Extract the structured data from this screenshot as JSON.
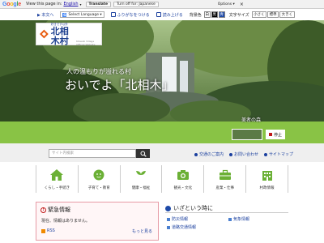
{
  "translate_bar": {
    "logo": [
      "G",
      "o",
      "o",
      "g",
      "l",
      "e"
    ],
    "view_text": "View this page in:",
    "language": "English",
    "translate_button": "Translate",
    "turn_off_button": "Turn off for: Japanese",
    "options": "Options ▾"
  },
  "utility": {
    "skip_link": "▶ 本文へ",
    "select_language": "Select Language",
    "furigana": "ふりがなをつける",
    "read_aloud": "読み上げる",
    "bg_label": "背景色",
    "bg_white": "白",
    "bg_black": "黒",
    "bg_blue": "青",
    "font_label": "文字サイズ",
    "font_small": "小さく",
    "font_std": "標準",
    "font_large": "大きく"
  },
  "header": {
    "logo_sub": "好きです以外",
    "logo_name": "北相木村",
    "logo_en": "Kitaaiki Village Official Website",
    "catch_small": "人の温もりが溢れる村",
    "catch_large": "おいでよ「北相木」",
    "photo_caption": "美者の森",
    "stop_label": "停止"
  },
  "search": {
    "placeholder": "サイト内検索",
    "link_traffic": "交通のご案内",
    "link_contact": "お問い合わせ",
    "link_sitemap": "サイトマップ"
  },
  "categories": [
    {
      "label": "くらし・手続き",
      "icon": "house-icon"
    },
    {
      "label": "子育て・教育",
      "icon": "child-icon"
    },
    {
      "label": "健康・福祉",
      "icon": "leaf-icon"
    },
    {
      "label": "観光・文化",
      "icon": "camera-icon"
    },
    {
      "label": "産業・仕事",
      "icon": "briefcase-icon"
    },
    {
      "label": "村政情報",
      "icon": "building-icon"
    }
  ],
  "emergency": {
    "title": "緊急情報",
    "body": "現在、情報はありません。",
    "rss": "RSS",
    "more": "もっと見る"
  },
  "iza": {
    "title": "いざという時に",
    "links": [
      "防災情報",
      "気象情報",
      "道路交通情報"
    ]
  },
  "colors": {
    "brand_blue": "#1c3f8f",
    "green_band": "#89c345",
    "alert_pink": "#e79aa5"
  }
}
